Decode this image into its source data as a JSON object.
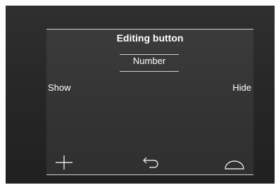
{
  "screen": {
    "title": "Editing button",
    "field_label": "Number",
    "left_option": "Show",
    "right_option": "Hide"
  },
  "icons": {
    "left": "plus-icon",
    "center": "back-arrow-icon",
    "right": "dome-icon"
  },
  "colors": {
    "frame": "#262626",
    "screen": "#353535",
    "text": "#ffffff",
    "rule": "#cfcfcf"
  }
}
